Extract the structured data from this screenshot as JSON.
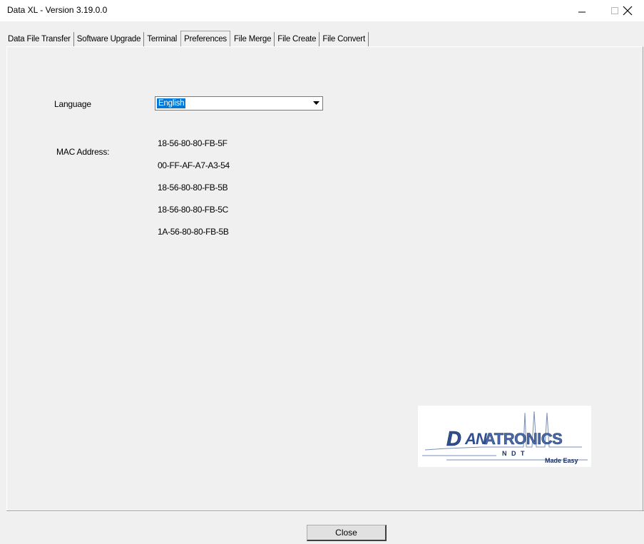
{
  "window": {
    "title": "Data XL - Version 3.19.0.0"
  },
  "tabs": [
    {
      "label": "Data File Transfer"
    },
    {
      "label": "Software Upgrade"
    },
    {
      "label": "Terminal"
    },
    {
      "label": "Preferences",
      "active": true
    },
    {
      "label": "File Merge"
    },
    {
      "label": "File Create"
    },
    {
      "label": "File Convert"
    }
  ],
  "preferences": {
    "language_label": "Language",
    "language_value": "English",
    "mac_label": "MAC Address:",
    "mac_addresses": [
      "18-56-80-80-FB-5F",
      "00-FF-AF-A7-A3-54",
      "18-56-80-80-FB-5B",
      "18-56-80-80-FB-5C",
      "1A-56-80-80-FB-5B"
    ]
  },
  "logo": {
    "name": "DANATRONICS",
    "sub": "N D T",
    "tagline": "Made Easy"
  },
  "footer": {
    "close_label": "Close"
  }
}
